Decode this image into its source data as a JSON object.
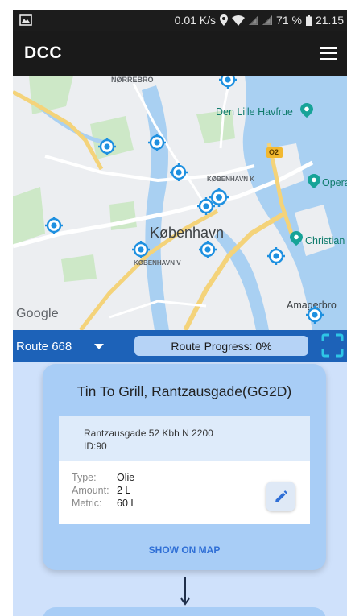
{
  "status_bar": {
    "speed": "0.01 K/s",
    "battery": "71 %",
    "time": "21.15",
    "icons": [
      "gallery-icon",
      "location-icon",
      "wifi-icon",
      "signal-icon",
      "signal-icon",
      "battery-icon"
    ]
  },
  "app_bar": {
    "title": "DCC",
    "menu_icon": "hamburger-menu-icon"
  },
  "map": {
    "labels": {
      "norrebro": "NØRREBRO",
      "den_lille_havfrue": "Den Lille Havfrue",
      "o2": "O2",
      "kobenhavn_k": "KØBENHAVN K",
      "opera": "Opera",
      "kobenhavn": "København",
      "christian": "Christian",
      "kobenhavn_v": "KØBENHAVN V",
      "amagerbro": "Amagerbro",
      "google": "Google"
    },
    "marker_icon": "location-target-icon",
    "colors": {
      "water": "#a9d0f2",
      "land": "#eceef1",
      "park": "#cde8c7",
      "marker": "#1e90e0",
      "major_road": "#f4d37a"
    }
  },
  "route_bar": {
    "route_label": "Route 668",
    "progress_label": "Route Progress: 0%",
    "progress_value": 0,
    "fullscreen_icon": "fullscreen-icon"
  },
  "stop_card": {
    "title": "Tin To Grill, Rantzausgade(GG2D)",
    "address": "Rantzausgade 52 Kbh N 2200",
    "id_label": "ID:90",
    "fields": [
      {
        "label": "Type:",
        "value": "Olie"
      },
      {
        "label": "Amount:",
        "value": "2 L"
      },
      {
        "label": "Metric:",
        "value": "60 L"
      }
    ],
    "edit_icon": "pencil-icon",
    "show_on_map_label": "SHOW ON MAP"
  },
  "colors": {
    "app_bar": "#1a1a1a",
    "route_bar": "#1d62b8",
    "card": "#a8cdf6",
    "background": "#cfe1fb",
    "accent": "#2f6fd6"
  }
}
